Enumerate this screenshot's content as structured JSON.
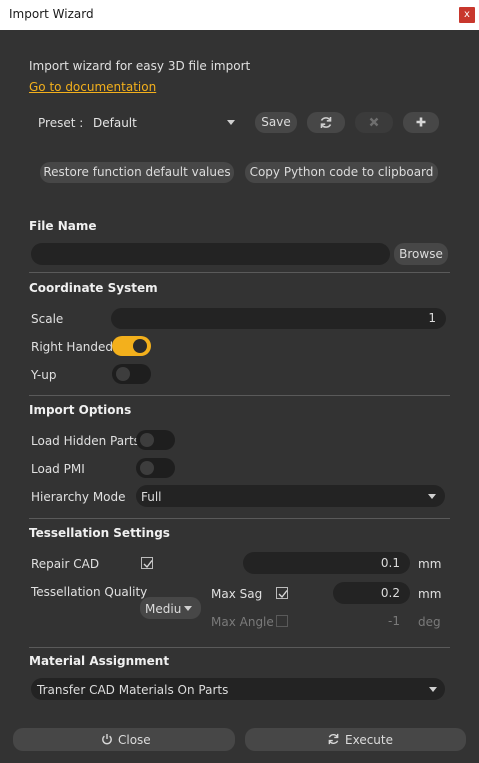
{
  "window": {
    "title": "Import Wizard",
    "close_glyph": "x"
  },
  "header": {
    "description": "Import wizard for easy 3D file import",
    "doc_link": "Go to documentation"
  },
  "preset": {
    "label": "Preset :",
    "value": "Default",
    "save_label": "Save",
    "icons": [
      "refresh-icon",
      "delete-icon",
      "add-icon"
    ]
  },
  "actions": {
    "restore_label": "Restore function default values",
    "copy_label": "Copy Python code to clipboard"
  },
  "file_name": {
    "section": "File Name",
    "value": "",
    "browse_label": "Browse"
  },
  "coordinate_system": {
    "section": "Coordinate System",
    "scale_label": "Scale",
    "scale_value": "1",
    "right_handed_label": "Right Handed",
    "right_handed_on": true,
    "y_up_label": "Y-up",
    "y_up_on": false
  },
  "import_options": {
    "section": "Import Options",
    "load_hidden_label": "Load Hidden Parts",
    "load_hidden_on": false,
    "load_pmi_label": "Load PMI",
    "load_pmi_on": false,
    "hierarchy_label": "Hierarchy Mode",
    "hierarchy_value": "Full"
  },
  "tessellation": {
    "section": "Tessellation Settings",
    "repair_label": "Repair CAD",
    "repair_checked": true,
    "repair_value": "0.1",
    "repair_unit": "mm",
    "quality_label": "Tessellation Quality",
    "quality_value": "Mediu",
    "max_sag_label": "Max Sag",
    "max_sag_checked": true,
    "max_sag_value": "0.2",
    "max_sag_unit": "mm",
    "max_angle_label": "Max Angle",
    "max_angle_checked": false,
    "max_angle_value": "-1",
    "max_angle_unit": "deg"
  },
  "material": {
    "section": "Material Assignment",
    "value": "Transfer CAD Materials On Parts"
  },
  "footer": {
    "close_label": "Close",
    "execute_label": "Execute"
  },
  "colors": {
    "accent": "#f3b01c",
    "background": "#333333",
    "field": "#232323",
    "button": "#474747",
    "close": "#c8372d"
  }
}
